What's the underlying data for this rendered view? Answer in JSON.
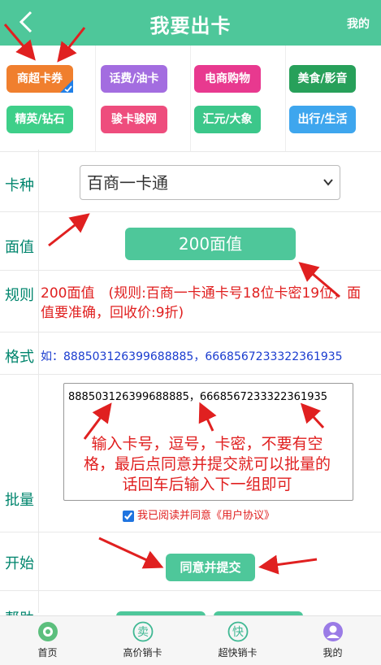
{
  "header": {
    "title": "我要出卡",
    "right_link": "我的"
  },
  "categories": [
    {
      "label": "商超卡券",
      "color": "#f07f2e",
      "selected": true
    },
    {
      "label": "话费/油卡",
      "color": "#a36de0"
    },
    {
      "label": "电商购物",
      "color": "#e8398f"
    },
    {
      "label": "美食/影音",
      "color": "#27a05a"
    },
    {
      "label": "精英/钻石",
      "color": "#3ecf89"
    },
    {
      "label": "骏卡骏网",
      "color": "#ee4d7d"
    },
    {
      "label": "汇元/大象",
      "color": "#3cc78a"
    },
    {
      "label": "出行/生活",
      "color": "#3ea6ee"
    }
  ],
  "form": {
    "card_type_label": "卡种",
    "card_type_value": "百商一卡通",
    "face_value_label": "面值",
    "face_value": "200面值",
    "rules_label": "规则",
    "rules_text": "200面值　(规则:百商一卡通卡号18位卡密19位，面值要准确，回收价:9折)",
    "format_label": "格式",
    "format_text": "如：888503126399688885，6668567233322361935",
    "batch_label": "批量",
    "batch_value": "888503126399688885，6668567233322361935",
    "annotation_text": "输入卡号，逗号，卡密，不要有空格，最后点同意并提交就可以批量的话回车后输入下一组即可",
    "agree_text": "我已阅读并同意《用户协议》",
    "agree_checked": true,
    "start_label": "开始",
    "submit_label": "同意并提交",
    "help_label": "帮助"
  },
  "tabbar": [
    {
      "label": "首页",
      "icon": "home-icon",
      "glyph": "",
      "color": "#5cbf7d"
    },
    {
      "label": "高价销卡",
      "icon": "sell-icon",
      "glyph": "卖",
      "color": "#3fb893"
    },
    {
      "label": "超快销卡",
      "icon": "fast-icon",
      "glyph": "快",
      "color": "#3fb893"
    },
    {
      "label": "我的",
      "icon": "user-icon",
      "glyph": "",
      "color": "#9a7be6"
    }
  ]
}
